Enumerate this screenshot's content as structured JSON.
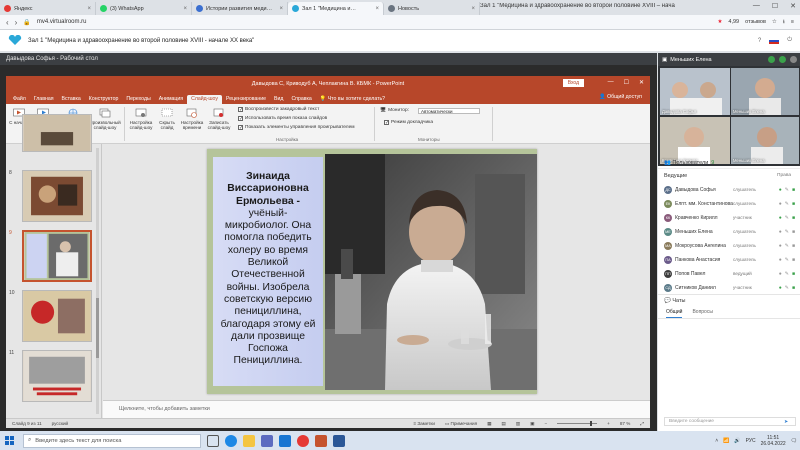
{
  "browser": {
    "tabs": [
      {
        "label": "Яндекс",
        "color": "#e53935"
      },
      {
        "label": "(3) WhatsApp",
        "color": "#25d366"
      },
      {
        "label": "Истории развития меди…",
        "color": "#3b6fd0"
      },
      {
        "label": "Зал 1 \"Медицина и…",
        "color": "#2aa8d8"
      },
      {
        "label": "Новость",
        "color": "#6a7480"
      }
    ],
    "window_title": "Зал 1 \"Медицина и здравоохранение во второй половине XVIII – начале XX века\" - Mirapolis Virtual Room",
    "url": "mv4.virtualroom.ru",
    "rating": "4,99",
    "reviews": "отзывов"
  },
  "room": {
    "title": "Зал 1 \"Медицина и здравоохранение во второй половине XVIII - начале XX века\""
  },
  "desktop": {
    "title": "Давыдова Софья - Рабочий стол"
  },
  "ppt": {
    "title": "Давыдова С, Криводуб А, Чеплакгина В. КБМК - PowerPoint",
    "login_label": "Вход",
    "share_label": "Общий доступ",
    "menu": [
      "Файл",
      "Главная",
      "Вставка",
      "Конструктор",
      "Переходы",
      "Анимация",
      "Слайд-шоу",
      "Рецензирование",
      "Вид",
      "Справка",
      "Что вы хотите сделать?"
    ],
    "ribbon": {
      "btn_from_start": "С начала",
      "btn_current": "С текущего слайда",
      "btn_online": "Онлайн-презентация",
      "btn_custom": "Произвольный слайд-шоу",
      "btn_setup": "Настройка слайд-шоу",
      "btn_hide": "Скрыть слайд",
      "btn_rehearse": "Настройка времени",
      "btn_record": "Записать слайд-шоу",
      "chk_narration": "Воспроизвести закадровый текст",
      "chk_timings": "Использовать время показа слайдов",
      "chk_controls": "Показать элементы управления проигрывателем",
      "monitor_label": "Монитор:",
      "monitor_value": "Автоматически",
      "presenter_view": "Режим докладчика",
      "group_start": "Начать слайд-шоу",
      "group_setup": "Настройка",
      "group_monitors": "Мониторы"
    },
    "thumb_numbers": [
      "8",
      "9",
      "10",
      "11"
    ],
    "slide_text": {
      "name": "Зинаида Виссарионовна Ермольева -",
      "body": "учёный-микробиолог. Она помогла победить холеру во время Великой Отечественной войны. Изобрела советскую версию пенициллина, благодаря этому ей дали прозвище Госпожа Пенициллина."
    },
    "notes_placeholder": "Щелкните, чтобы добавить заметки",
    "status": {
      "slide": "Слайд 9 из 11",
      "lang": "русский",
      "notes": "Заметки",
      "comments": "Примечания",
      "zoom": "87 %"
    }
  },
  "right_panel": {
    "top_user": "Меньших Елена",
    "videos": [
      {
        "label": "Давыдова Софья"
      },
      {
        "label": "Меньших Елена"
      },
      {
        "label": "Кравченко Кирилл"
      },
      {
        "label": "Меньших Елена"
      }
    ],
    "leads_label": "Ведущие",
    "rights_label": "Права",
    "users_label": "Пользователи",
    "users_count": "9",
    "users": [
      {
        "initials": "ДС",
        "name": "Давыдова Софья",
        "role": "слушатель",
        "color": "#5b6f8a"
      },
      {
        "initials": "ЕК",
        "name": "Елпт. мм. Константинова…",
        "role": "слушатель",
        "color": "#7b8a5b"
      },
      {
        "initials": "КК",
        "name": "Кравченко Кирилл",
        "role": "участник",
        "color": "#8a5b7b"
      },
      {
        "initials": "МЕ",
        "name": "Меньших Елена",
        "role": "слушатель",
        "color": "#5b8a86"
      },
      {
        "initials": "МА",
        "name": "Мокроусова Ангелина",
        "role": "слушатель",
        "color": "#8a7b5b"
      },
      {
        "initials": "ПА",
        "name": "Панкова Анастасия",
        "role": "слушатель",
        "color": "#6b5b8a"
      },
      {
        "initials": "ПП",
        "name": "Попов Павел",
        "role": "ведущий",
        "color": "#3d3d3d"
      },
      {
        "initials": "СД",
        "name": "Ситников Даниил",
        "role": "участник",
        "color": "#5b7b8a"
      }
    ],
    "chats_label": "Чаты",
    "chat_tabs": [
      "Общий",
      "Вопросы"
    ],
    "chat_placeholder": "Введите сообщение"
  },
  "taskbar": {
    "search_placeholder": "Введите здесь текст для поиска",
    "lang": "РУС",
    "time": "11:51",
    "date": "26.04.2022"
  }
}
